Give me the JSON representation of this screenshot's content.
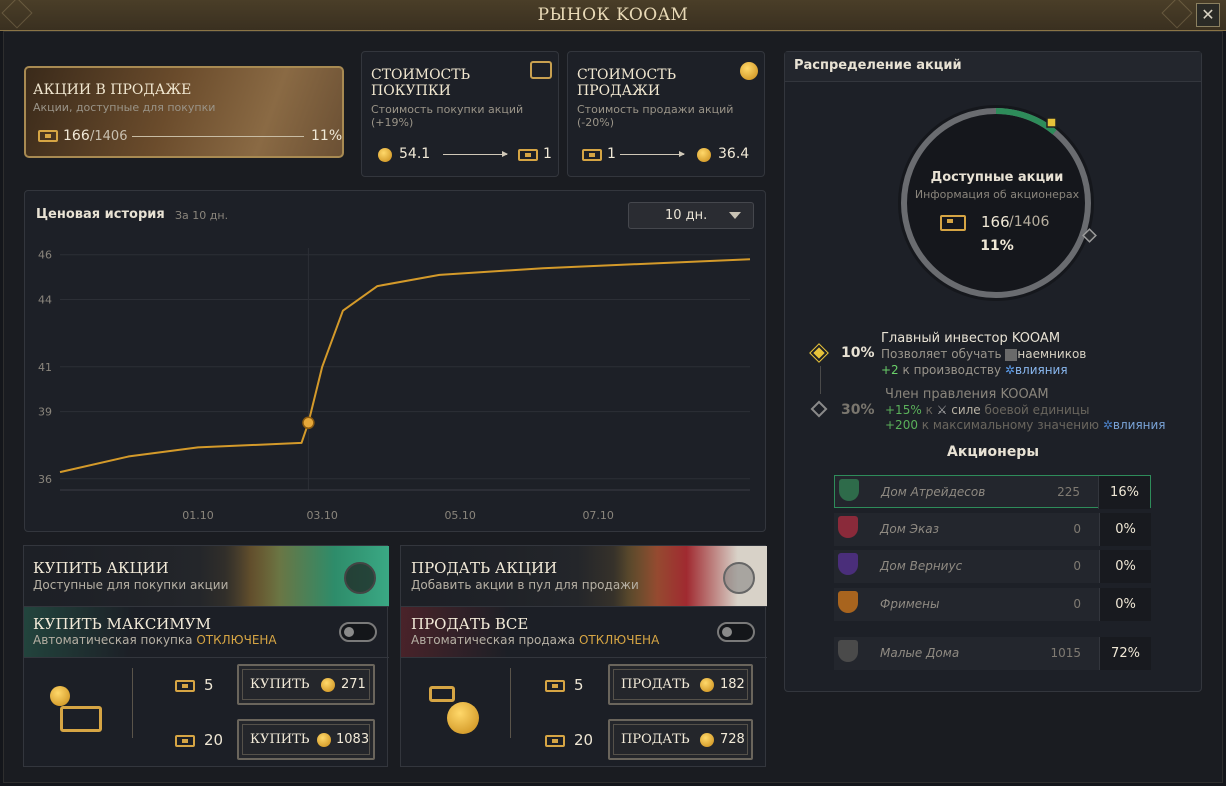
{
  "window": {
    "title": "РЫНОК KOOAM",
    "close_label": "✕"
  },
  "cards": {
    "sale": {
      "title": "АКЦИИ В ПРОДАЖЕ",
      "subtitle": "Акции, доступные для покупки",
      "available": "166",
      "total": "/1406",
      "percent": "11%"
    },
    "buy_cost": {
      "title_line1": "СТОИМОСТЬ",
      "title_line2": "ПОКУПКИ",
      "subtitle": "Стоимость покупки акций (+19%)",
      "from_value": "54.1",
      "to_value": "1"
    },
    "sell_cost": {
      "title_line1": "СТОИМОСТЬ",
      "title_line2": "ПРОДАЖИ",
      "subtitle": "Стоимость продажи акций (-20%)",
      "from_value": "1",
      "to_value": "36.4"
    }
  },
  "chart_panel": {
    "title": "Ценовая история",
    "subtitle": "За 10 дн.",
    "dropdown_value": "10 дн."
  },
  "chart_data": {
    "type": "line",
    "x_ticks": [
      "01.10",
      "03.10",
      "05.10",
      "07.10"
    ],
    "y_ticks": [
      36,
      39,
      41,
      44,
      46
    ],
    "ylim": [
      35.5,
      46.3
    ],
    "series": [
      {
        "points": [
          [
            0.0,
            36.3
          ],
          [
            1.0,
            37.0
          ],
          [
            2.0,
            37.4
          ],
          [
            3.5,
            37.6
          ],
          [
            3.6,
            38.5
          ],
          [
            3.8,
            41.0
          ],
          [
            4.1,
            43.5
          ],
          [
            4.6,
            44.6
          ],
          [
            5.5,
            45.1
          ],
          [
            7.0,
            45.4
          ],
          [
            8.5,
            45.6
          ],
          [
            10.0,
            45.8
          ]
        ]
      }
    ],
    "marker": {
      "x": 3.6,
      "y": 38.5
    },
    "colors": {
      "line": "#d49a2a",
      "marker": "#e6a83a"
    }
  },
  "buy": {
    "banner_title": "КУПИТЬ АКЦИИ",
    "banner_sub": "Доступные для покупки акции",
    "max_title": "КУПИТЬ МАКСИМУМ",
    "max_sub": "Автоматическая покупка",
    "max_state": "ОТКЛЮЧЕНА",
    "rows": [
      {
        "qty": "5",
        "label": "КУПИТЬ",
        "price": "271"
      },
      {
        "qty": "20",
        "label": "КУПИТЬ",
        "price": "1083"
      }
    ]
  },
  "sell": {
    "banner_title": "ПРОДАТЬ АКЦИИ",
    "banner_sub": "Добавить акции в пул для продажи",
    "all_title": "ПРОДАТЬ ВСЕ",
    "all_sub": "Автоматическая продажа",
    "all_state": "ОТКЛЮЧЕНА",
    "rows": [
      {
        "qty": "5",
        "label": "ПРОДАТЬ",
        "price": "182"
      },
      {
        "qty": "20",
        "label": "ПРОДАТЬ",
        "price": "728"
      }
    ]
  },
  "distribution": {
    "title": "Распределение акций",
    "ring_title": "Доступные акции",
    "ring_sub": "Информация об акционерах",
    "available": "166",
    "total": "/1406",
    "percent": "11%",
    "ring_fraction": 0.11,
    "tiers": [
      {
        "pct": "10%",
        "name": "Главный инвестор KOOAM",
        "line1_a": "Позволяет обучать",
        "line1_b": "наемников",
        "line2_a": "+2",
        "line2_b": "к производству",
        "line2_c": "влияния"
      },
      {
        "pct": "30%",
        "name": "Член правления KOOAM",
        "line1_a": "+15%",
        "line1_b": "к",
        "line1_c": "силе",
        "line1_d": "боевой единицы",
        "line2_a": "+200",
        "line2_b": "к максимальному значению",
        "line2_c": "влияния"
      }
    ],
    "holders_title": "Акционеры",
    "holders": [
      {
        "name": "Дом Атрейдесов",
        "count": "225",
        "pct": "16%",
        "color": "#2e6b4a"
      },
      {
        "name": "Дом Эказ",
        "count": "0",
        "pct": "0%",
        "color": "#8a2a3a"
      },
      {
        "name": "Дом Верниус",
        "count": "0",
        "pct": "0%",
        "color": "#4a2e7a"
      },
      {
        "name": "Фримены",
        "count": "0",
        "pct": "0%",
        "color": "#a8641e"
      }
    ],
    "minor": {
      "name": "Малые Дома",
      "count": "1015",
      "pct": "72%",
      "color": "#4a4a4a"
    }
  }
}
